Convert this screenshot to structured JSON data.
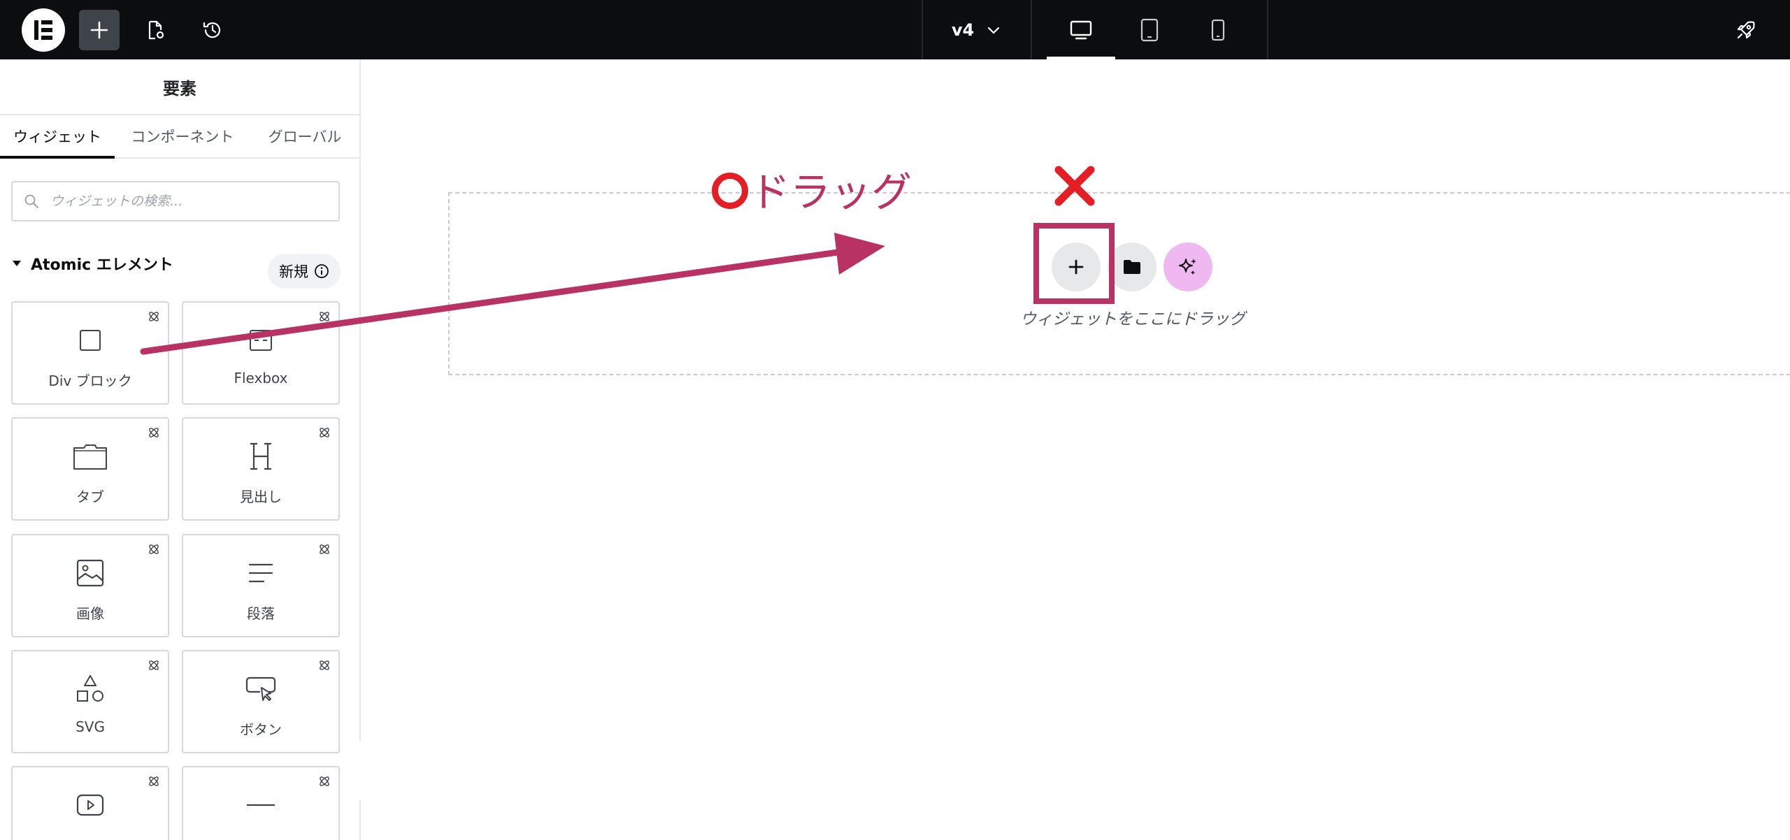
{
  "topbar": {
    "logo_icon": "elementor-logo-icon",
    "add_icon": "plus-icon",
    "page_settings_icon": "page-settings-icon",
    "history_icon": "history-icon",
    "version_label": "v4",
    "devices": [
      "desktop-icon",
      "tablet-icon",
      "mobile-icon"
    ],
    "active_device": "desktop",
    "publish_icon": "rocket-icon"
  },
  "sidebar": {
    "title": "要素",
    "tabs": [
      {
        "label": "ウィジェット",
        "active": true
      },
      {
        "label": "コンポーネント",
        "active": false
      },
      {
        "label": "グローバル",
        "active": false
      }
    ],
    "search_placeholder": "ウィジェットの検索...",
    "category": {
      "label": "Atomic エレメント",
      "badge": "新規"
    },
    "widgets": [
      {
        "label": "Div ブロック",
        "icon": "div-block-icon"
      },
      {
        "label": "Flexbox",
        "icon": "flexbox-icon"
      },
      {
        "label": "タブ",
        "icon": "tabs-icon"
      },
      {
        "label": "見出し",
        "icon": "heading-icon"
      },
      {
        "label": "画像",
        "icon": "image-icon"
      },
      {
        "label": "段落",
        "icon": "paragraph-icon"
      },
      {
        "label": "SVG",
        "icon": "svg-shapes-icon"
      },
      {
        "label": "ボタン",
        "icon": "button-icon"
      },
      {
        "label": "",
        "icon": "video-icon"
      },
      {
        "label": "",
        "icon": "divider-icon"
      }
    ]
  },
  "canvas": {
    "drop_text": "ウィジェットをここにドラッグ",
    "buttons": [
      "add-section-icon",
      "template-library-icon",
      "ai-sparkle-icon"
    ]
  },
  "annotation": {
    "drag_text": "ドラッグ",
    "color": "#b83264",
    "mark_color": "#e31e24"
  }
}
